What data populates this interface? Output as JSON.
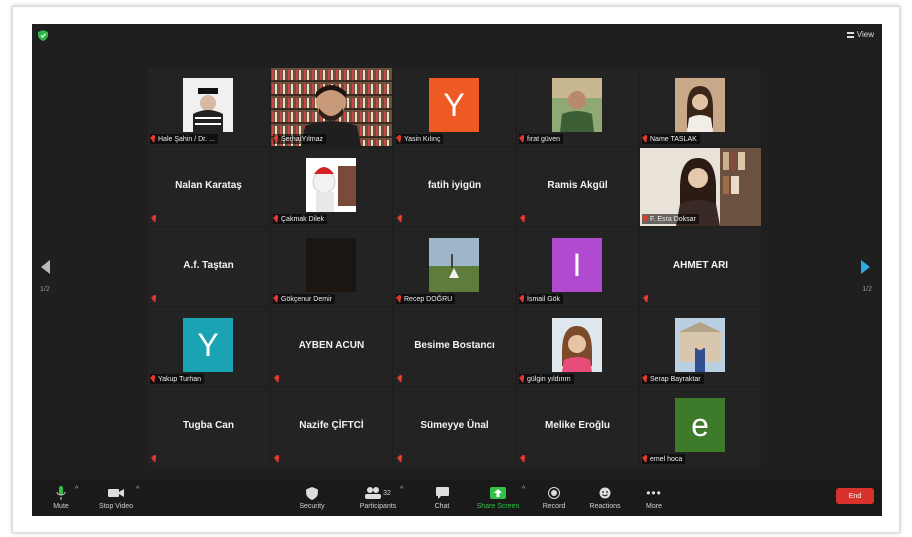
{
  "window": {
    "view_label": "View"
  },
  "pagination": {
    "left_page": "1/2",
    "right_page": "1/2"
  },
  "tiles": [
    {
      "label": "Hale Şahin / Dr. ...",
      "type": "photo",
      "photo": "hat"
    },
    {
      "label": "SerhatYılmaz",
      "type": "video",
      "active": true
    },
    {
      "label": "Yasin Kılınç",
      "type": "letter",
      "letter": "Y",
      "color": "#ee5a24"
    },
    {
      "label": "fırat güven",
      "type": "photo",
      "photo": "outdoor"
    },
    {
      "label": "Name TASLAK",
      "type": "photo",
      "photo": "woman"
    },
    {
      "label": "",
      "type": "name",
      "big": "Nalan Karataş"
    },
    {
      "label": "Çakmak Dilek",
      "type": "photo",
      "photo": "santa"
    },
    {
      "label": "",
      "type": "name",
      "big": "fatih iyigün"
    },
    {
      "label": "",
      "type": "name",
      "big": "Ramis Akgül"
    },
    {
      "label": "F. Esra Doksar",
      "type": "video2"
    },
    {
      "label": "",
      "type": "name",
      "big": "A.f. Taştan"
    },
    {
      "label": "Gökçenur Demir",
      "type": "photo",
      "photo": "dark"
    },
    {
      "label": "Recep DOĞRU",
      "type": "photo",
      "photo": "field"
    },
    {
      "label": "İsmail Gök",
      "type": "letter",
      "letter": "I",
      "color": "#b04bcf"
    },
    {
      "label": "",
      "type": "name",
      "big": "AHMET ARI"
    },
    {
      "label": "Yakup Turhan",
      "type": "letter",
      "letter": "Y",
      "color": "#1aa3b3"
    },
    {
      "label": "",
      "type": "name",
      "big": "AYBEN ACUN"
    },
    {
      "label": "",
      "type": "name",
      "big": "Besime Bostancı"
    },
    {
      "label": "gülgin yıldırım",
      "type": "photo",
      "photo": "woman2"
    },
    {
      "label": "Serap Bayraktar",
      "type": "photo",
      "photo": "building"
    },
    {
      "label": "",
      "type": "name",
      "big": "Tugba Can"
    },
    {
      "label": "",
      "type": "name",
      "big": "Nazife ÇİFTCİ"
    },
    {
      "label": "",
      "type": "name",
      "big": "Sümeyye Ünal"
    },
    {
      "label": "",
      "type": "name",
      "big": "Melike Eroğlu"
    },
    {
      "label": "emel hoca",
      "type": "letter",
      "letter": "e",
      "color": "#3d7b2a"
    }
  ],
  "toolbar": {
    "mute": "Mute",
    "stop_video": "Stop Video",
    "security": "Security",
    "participants": "Participants",
    "participant_count": "32",
    "chat": "Chat",
    "share_screen": "Share Screen",
    "record": "Record",
    "reactions": "Reactions",
    "more": "More",
    "end": "End"
  },
  "colors": {
    "accent_green": "#33c04a",
    "end_red": "#d7322b",
    "active_border": "#b9d33a",
    "nav_blue": "#33a6e6"
  }
}
